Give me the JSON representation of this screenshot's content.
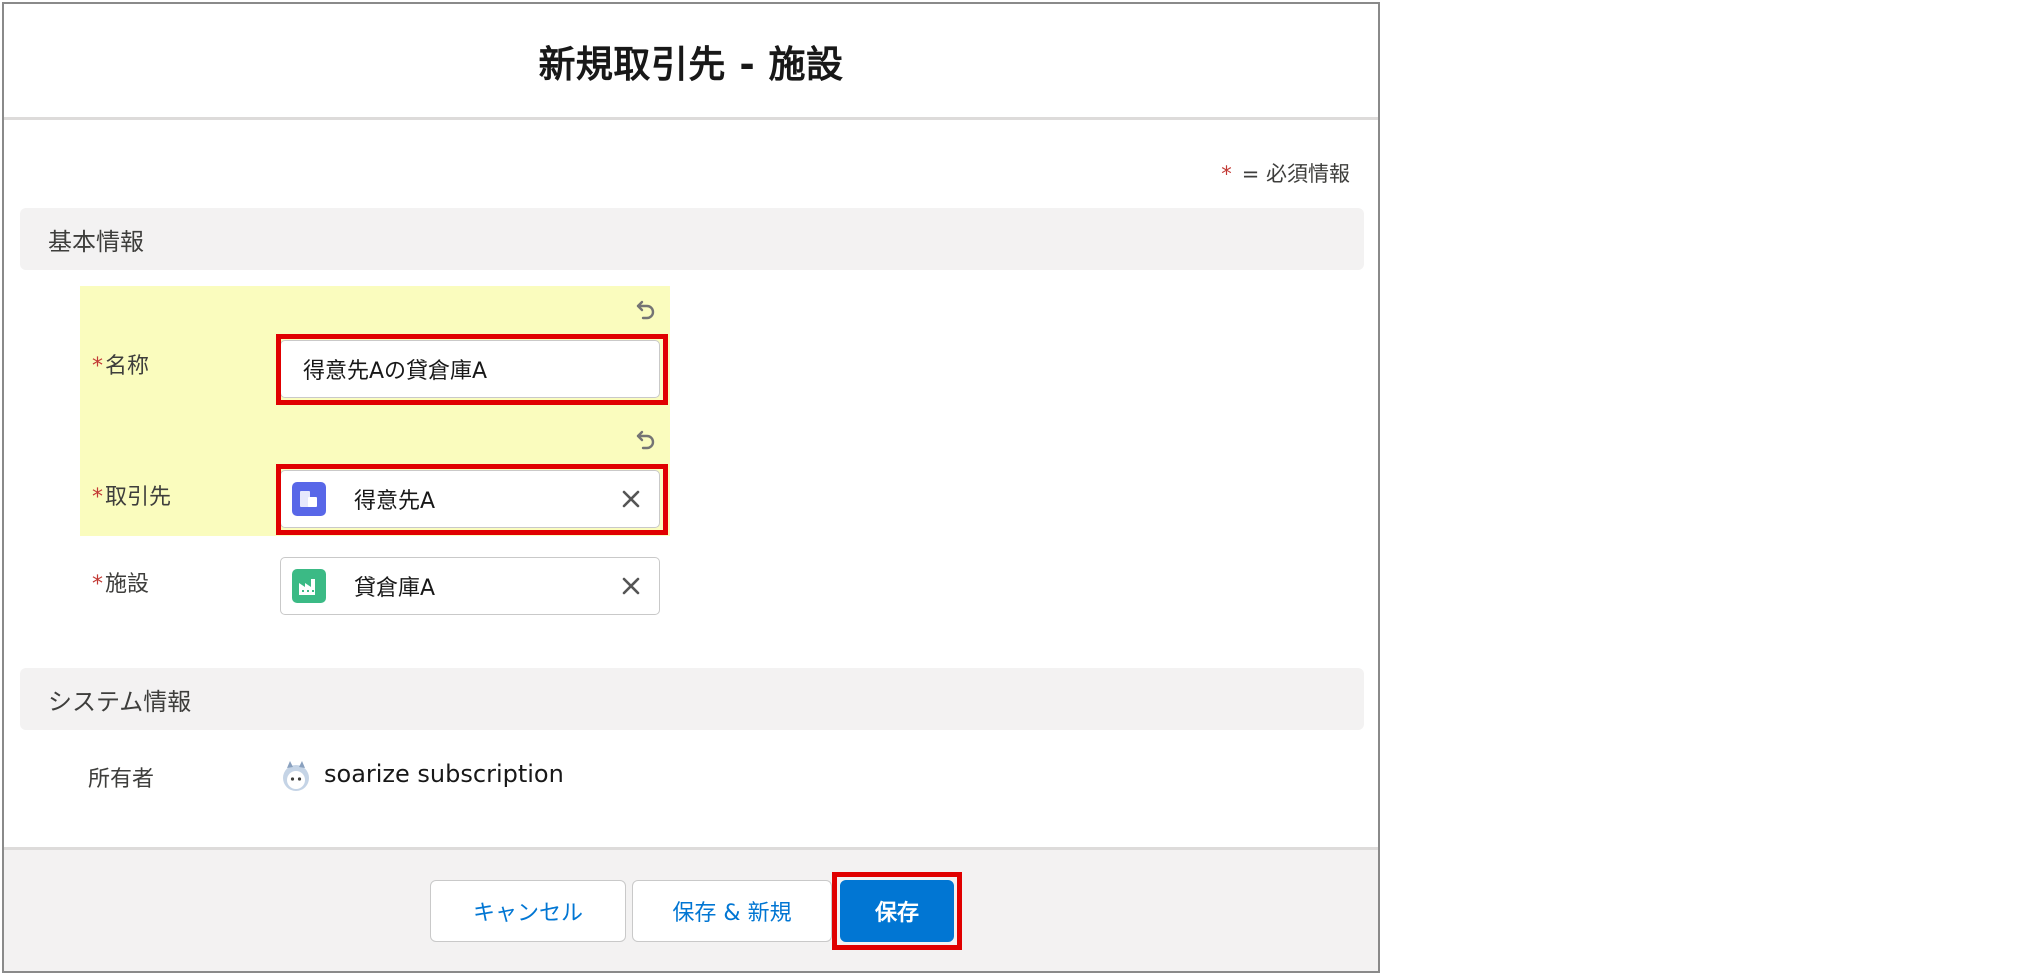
{
  "modal": {
    "title": "新規取引先 - 施設"
  },
  "required_legend": {
    "star": "*",
    "text": "= 必須情報"
  },
  "sections": {
    "basic": "基本情報",
    "system": "システム情報"
  },
  "fields": {
    "name": {
      "required_mark": "*",
      "label": "名称",
      "value": "得意先Aの貸倉庫A"
    },
    "account": {
      "required_mark": "*",
      "label": "取引先",
      "value": "得意先A",
      "icon": "account-icon"
    },
    "facility": {
      "required_mark": "*",
      "label": "施設",
      "value": "貸倉庫A",
      "icon": "facility-icon"
    }
  },
  "owner": {
    "label": "所有者",
    "value": "soarize subscription"
  },
  "footer": {
    "cancel_label": "キャンセル",
    "save_new_label": "保存 & 新規",
    "save_label": "保存"
  },
  "colors": {
    "highlight": "#fafcbe",
    "emphasis_frame": "#e00000",
    "brand_button": "#0176d3",
    "account_icon": "#5867e8",
    "facility_icon": "#3bba85",
    "required": "#c23934"
  }
}
